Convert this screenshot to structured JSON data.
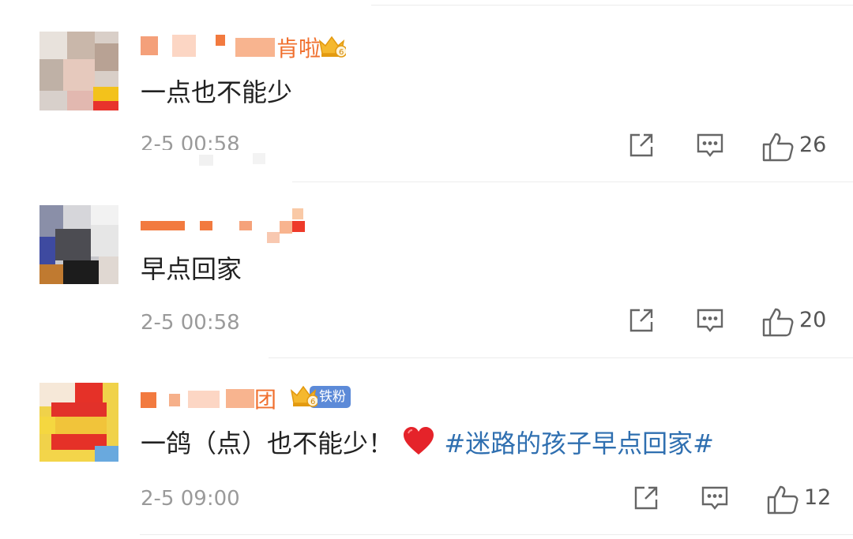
{
  "comments": [
    {
      "username_visible": "肯啦",
      "content": "一点也不能少",
      "time": "2-5 00:58",
      "likes": "26",
      "badge": "crown-level-6"
    },
    {
      "username_visible": "",
      "content": "早点回家",
      "time": "2-5 00:58",
      "likes": "20",
      "badge": ""
    },
    {
      "username_visible": "团",
      "content_text": "一鸽（点）也不能少！",
      "content_topic": "#迷路的孩子早点回家#",
      "time": "2-5 09:00",
      "likes": "12",
      "badge": "crown-level-6",
      "fan_badge": "铁粉"
    }
  ],
  "icons": {
    "share": "share-icon",
    "comment": "comment-icon",
    "like": "like-icon",
    "heart": "heart-icon"
  },
  "colors": {
    "username": "#f0702f",
    "topic": "#2f6fb0",
    "heart": "#e5232a",
    "fan_badge": "#5c8ad8"
  }
}
